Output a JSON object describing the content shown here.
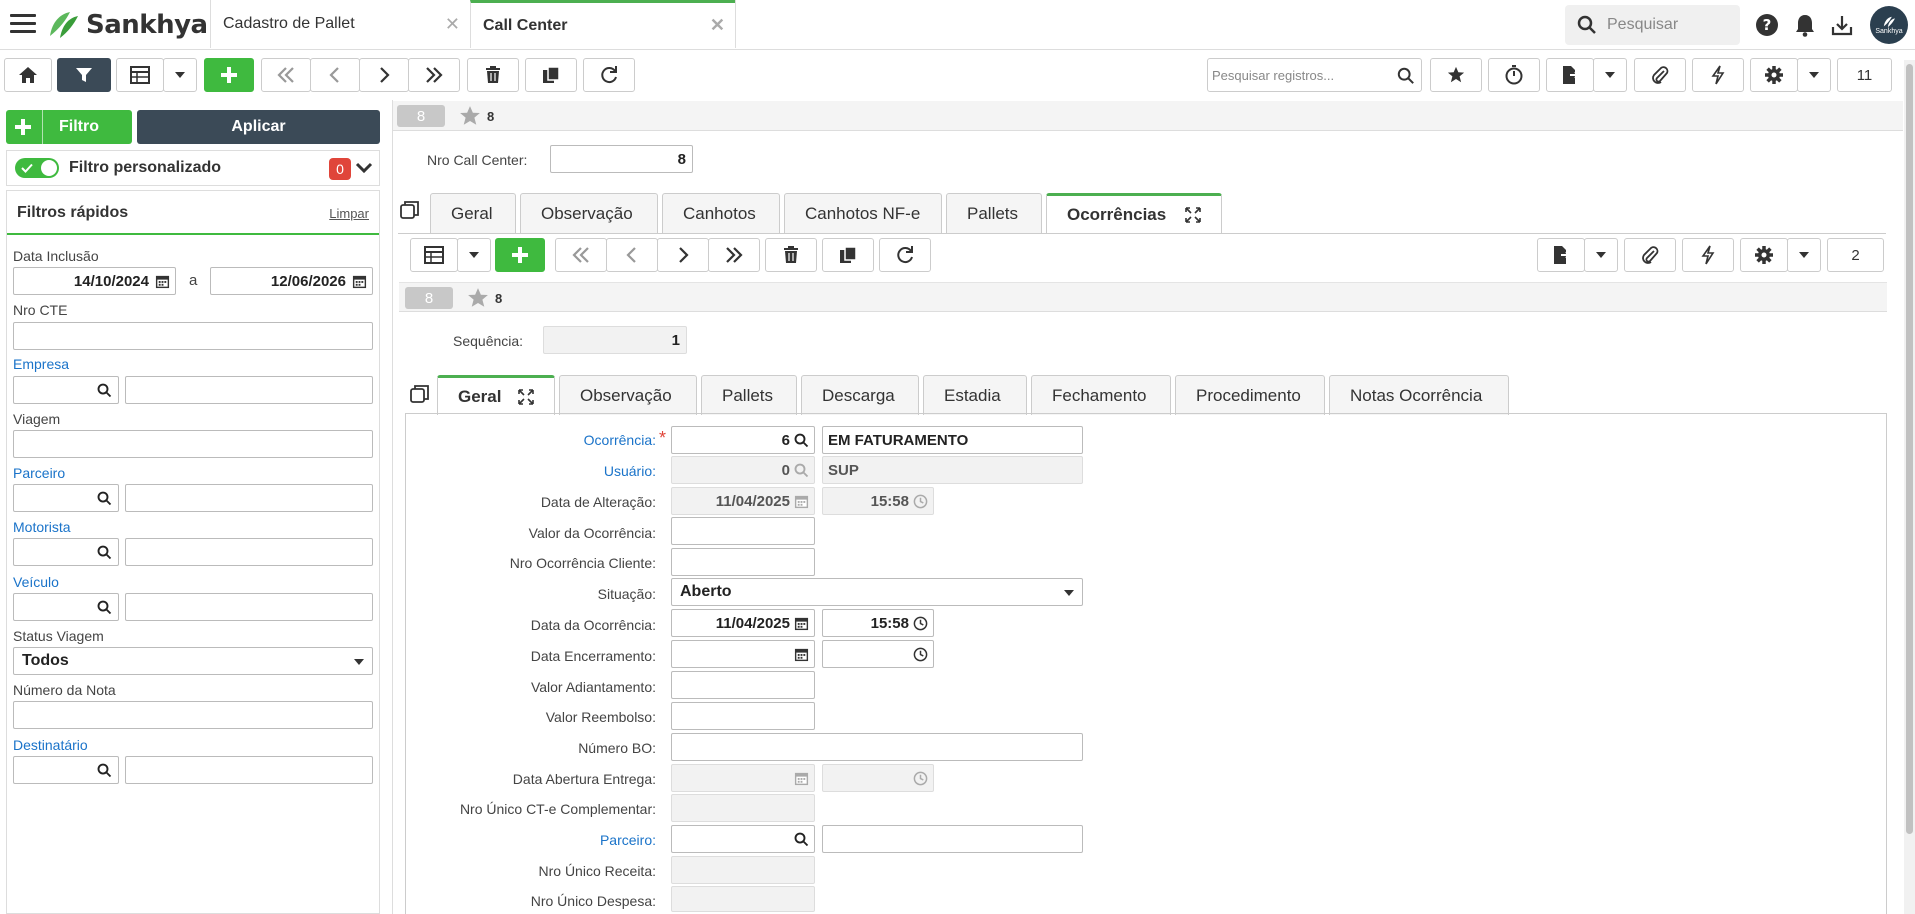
{
  "topbar": {
    "brand": "Sankhya",
    "tabs": [
      {
        "label": "Cadastro de Pallet",
        "active": false
      },
      {
        "label": "Call Center",
        "active": true
      }
    ],
    "search_placeholder": "Pesquisar",
    "avatar_text": "Sankhya"
  },
  "toolbar": {
    "search_placeholder": "Pesquisar registros...",
    "record_count": "11"
  },
  "filter_panel": {
    "filtro_label": "Filtro",
    "aplicar_label": "Aplicar",
    "custom_filter_label": "Filtro personalizado",
    "custom_filter_count": "0",
    "quick_filters_title": "Filtros rápidos",
    "clear_label": "Limpar",
    "data_inclusao_label": "Data Inclusão",
    "data_inclusao_from": "14/10/2024",
    "data_inclusao_sep": "a",
    "data_inclusao_to": "12/06/2026",
    "nro_cte_label": "Nro CTE",
    "empresa_label": "Empresa",
    "viagem_label": "Viagem",
    "parceiro_label": "Parceiro",
    "motorista_label": "Motorista",
    "veiculo_label": "Veículo",
    "status_viagem_label": "Status Viagem",
    "status_viagem_value": "Todos",
    "numero_nota_label": "Número da Nota",
    "destinatario_label": "Destinatário"
  },
  "record_header": {
    "badge": "8",
    "id": "8",
    "nro_call_center_label": "Nro Call Center:",
    "nro_call_center_value": "8"
  },
  "main_tabs": [
    "Geral",
    "Observação",
    "Canhotos",
    "Canhotos NF-e",
    "Pallets",
    "Ocorrências"
  ],
  "sub_toolbar": {
    "record_count": "2"
  },
  "sub_record": {
    "badge": "8",
    "id": "8",
    "sequencia_label": "Sequência:",
    "sequencia_value": "1"
  },
  "sub_tabs": [
    "Geral",
    "Observação",
    "Pallets",
    "Descarga",
    "Estadia",
    "Fechamento",
    "Procedimento",
    "Notas Ocorrência"
  ],
  "form": {
    "ocorrencia_label": "Ocorrência:",
    "ocorrencia_code": "6",
    "ocorrencia_desc": "EM FATURAMENTO",
    "usuario_label": "Usuário:",
    "usuario_code": "0",
    "usuario_desc": "SUP",
    "data_alteracao_label": "Data de Alteração:",
    "data_alteracao_date": "11/04/2025",
    "data_alteracao_time": "15:58",
    "valor_ocorrencia_label": "Valor da Ocorrência:",
    "nro_ocorrencia_cliente_label": "Nro Ocorrência Cliente:",
    "situacao_label": "Situação:",
    "situacao_value": "Aberto",
    "data_ocorrencia_label": "Data da Ocorrência:",
    "data_ocorrencia_date": "11/04/2025",
    "data_ocorrencia_time": "15:58",
    "data_encerramento_label": "Data Encerramento:",
    "valor_adiantamento_label": "Valor Adiantamento:",
    "valor_reembolso_label": "Valor Reembolso:",
    "numero_bo_label": "Número BO:",
    "data_abertura_entrega_label": "Data Abertura Entrega:",
    "nro_unico_cte_label": "Nro Único CT-e Complementar:",
    "parceiro_label": "Parceiro:",
    "nro_unico_receita_label": "Nro Único Receita:",
    "nro_unico_despesa_label": "Nro Único Despesa:"
  },
  "colors": {
    "accent_green": "#3fba3f",
    "dark_button": "#3b4a57",
    "link_blue": "#1a73c9",
    "badge_red": "#e0453a"
  }
}
